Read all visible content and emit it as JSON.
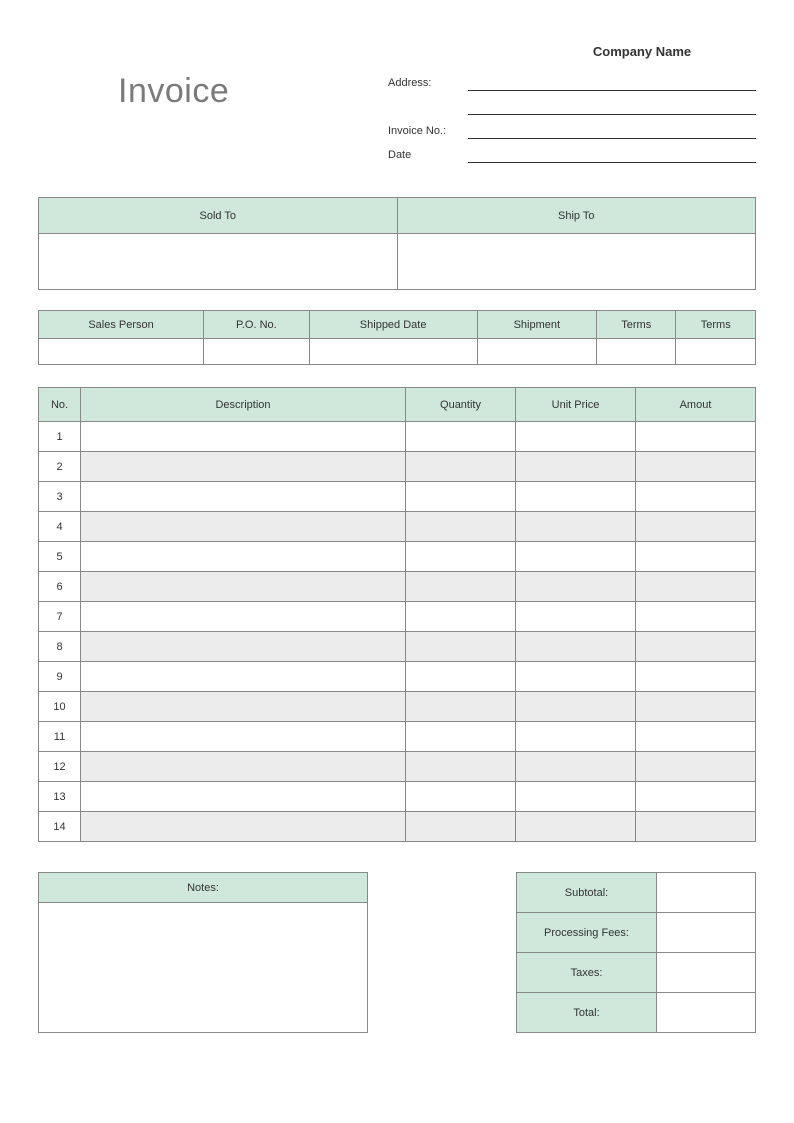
{
  "header": {
    "title": "Invoice",
    "company_name": "Company Name",
    "address_label": "Address:",
    "invoice_no_label": "Invoice No.:",
    "date_label": "Date",
    "address_line1": "",
    "address_line2": "",
    "invoice_no": "",
    "date": ""
  },
  "soldship": {
    "sold_to_label": "Sold To",
    "ship_to_label": "Ship To",
    "sold_to": "",
    "ship_to": ""
  },
  "meta": {
    "headers": [
      "Sales Person",
      "P.O. No.",
      "Shipped Date",
      "Shipment",
      "Terms",
      "Terms"
    ],
    "values": [
      "",
      "",
      "",
      "",
      "",
      ""
    ]
  },
  "items": {
    "headers": {
      "no": "No.",
      "description": "Description",
      "quantity": "Quantity",
      "unit_price": "Unit Price",
      "amount": "Amout"
    },
    "rows": [
      {
        "no": "1",
        "description": "",
        "quantity": "",
        "unit_price": "",
        "amount": ""
      },
      {
        "no": "2",
        "description": "",
        "quantity": "",
        "unit_price": "",
        "amount": ""
      },
      {
        "no": "3",
        "description": "",
        "quantity": "",
        "unit_price": "",
        "amount": ""
      },
      {
        "no": "4",
        "description": "",
        "quantity": "",
        "unit_price": "",
        "amount": ""
      },
      {
        "no": "5",
        "description": "",
        "quantity": "",
        "unit_price": "",
        "amount": ""
      },
      {
        "no": "6",
        "description": "",
        "quantity": "",
        "unit_price": "",
        "amount": ""
      },
      {
        "no": "7",
        "description": "",
        "quantity": "",
        "unit_price": "",
        "amount": ""
      },
      {
        "no": "8",
        "description": "",
        "quantity": "",
        "unit_price": "",
        "amount": ""
      },
      {
        "no": "9",
        "description": "",
        "quantity": "",
        "unit_price": "",
        "amount": ""
      },
      {
        "no": "10",
        "description": "",
        "quantity": "",
        "unit_price": "",
        "amount": ""
      },
      {
        "no": "11",
        "description": "",
        "quantity": "",
        "unit_price": "",
        "amount": ""
      },
      {
        "no": "12",
        "description": "",
        "quantity": "",
        "unit_price": "",
        "amount": ""
      },
      {
        "no": "13",
        "description": "",
        "quantity": "",
        "unit_price": "",
        "amount": ""
      },
      {
        "no": "14",
        "description": "",
        "quantity": "",
        "unit_price": "",
        "amount": ""
      }
    ]
  },
  "notes": {
    "label": "Notes:",
    "value": ""
  },
  "totals": {
    "subtotal_label": "Subtotal:",
    "processing_label": "Processing Fees:",
    "taxes_label": "Taxes:",
    "total_label": "Total:",
    "subtotal": "",
    "processing": "",
    "taxes": "",
    "total": ""
  }
}
